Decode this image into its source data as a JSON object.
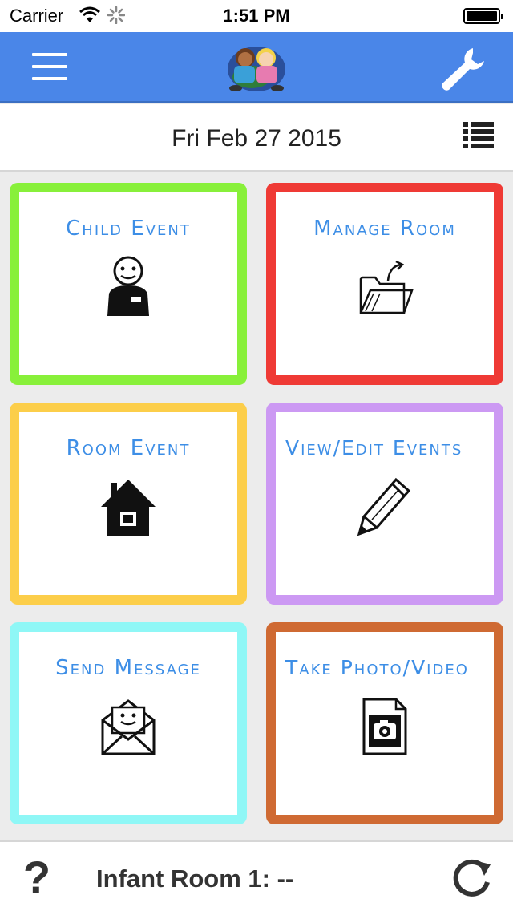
{
  "status_bar": {
    "carrier": "Carrier",
    "time": "1:51 PM",
    "wifi_icon": "wifi-icon",
    "activity_icon": "spinner-icon",
    "battery_icon": "battery-icon"
  },
  "nav": {
    "menu_icon": "hamburger-menu-icon",
    "logo": "children-logo",
    "settings_icon": "wrench-icon",
    "accent_color": "#4a86e8"
  },
  "date_row": {
    "date": "Fri Feb 27 2015",
    "list_icon": "list-icon"
  },
  "tiles": [
    {
      "label": "Child Event",
      "icon": "child-face-icon",
      "color": "#88f03a"
    },
    {
      "label": "Manage Room",
      "icon": "folder-export-icon",
      "color": "#ef3a35"
    },
    {
      "label": "Room Event",
      "icon": "house-icon",
      "color": "#fcce4a"
    },
    {
      "label": "View/Edit Events",
      "icon": "pencil-icon",
      "color": "#cc99f3"
    },
    {
      "label": "Send Message",
      "icon": "envelope-icon",
      "color": "#8ff7f6"
    },
    {
      "label": "Take Photo/Video",
      "icon": "camera-file-icon",
      "color": "#cf6a33"
    }
  ],
  "bottom_bar": {
    "help_label": "?",
    "room_status": "Infant Room 1: --",
    "refresh_icon": "refresh-icon"
  }
}
